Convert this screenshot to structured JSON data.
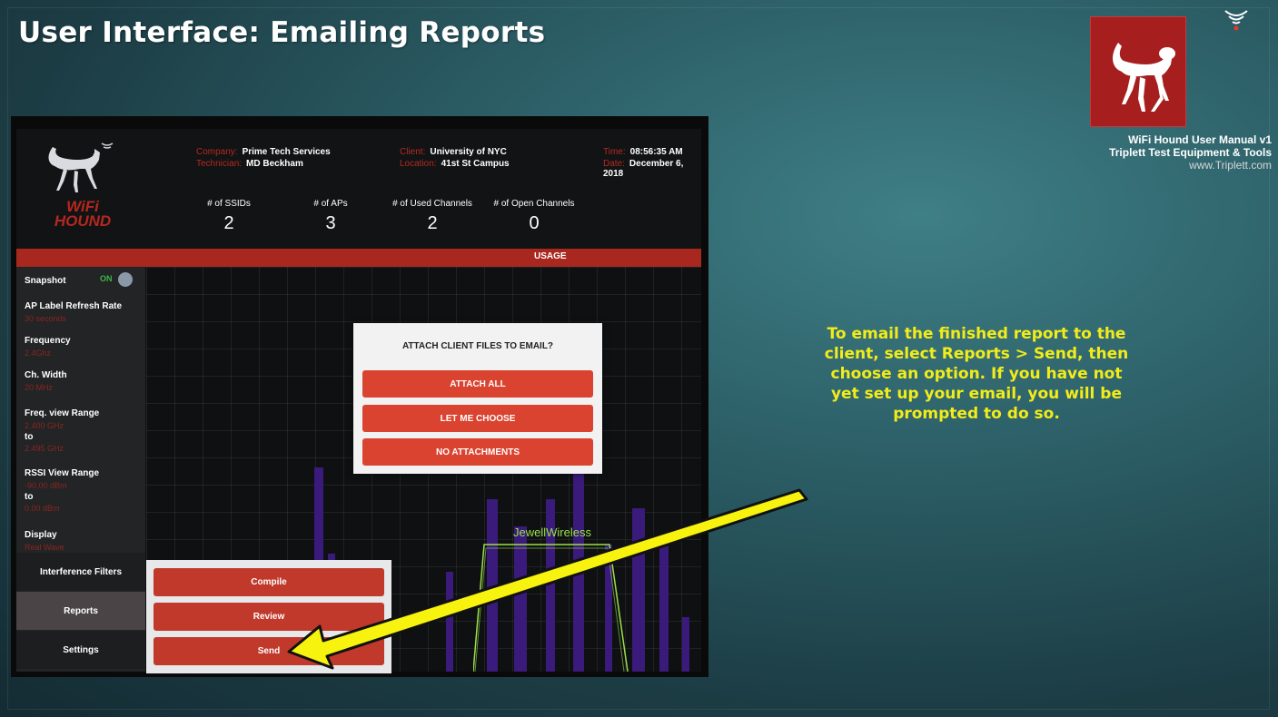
{
  "slide": {
    "title": "User Interface: Emailing Reports",
    "credits": [
      "WiFi Hound User Manual v1",
      "Triplett Test Equipment & Tools",
      "www.Triplett.com"
    ],
    "instructions": "To email the finished report to the client, select Reports > Send, then choose an option. If you have not yet set up your email, you will be prompted to do so.",
    "colors": {
      "accent_yellow": "#f2ec1a",
      "brand_red": "#a61e1e"
    },
    "icons": [
      "dog-logo-icon",
      "wifi-signal-icon",
      "arrow-pointer-icon"
    ]
  },
  "app": {
    "brand": "WiFi HOUND",
    "header": {
      "company_label": "Company:",
      "company": "Prime Tech Services",
      "technician_label": "Technician:",
      "technician": "MD Beckham",
      "client_label": "Client:",
      "client": "University of NYC",
      "location_label": "Location:",
      "location": "41st St Campus",
      "time_label": "Time:",
      "time": "08:56:35 AM",
      "date_label": "Date:",
      "date": "December 6, 2018"
    },
    "stats": [
      {
        "label": "# of SSIDs",
        "value": "2"
      },
      {
        "label": "# of APs",
        "value": "3"
      },
      {
        "label": "# of Used Channels",
        "value": "2"
      },
      {
        "label": "# of Open Channels",
        "value": "0"
      }
    ],
    "usage_label": "USAGE",
    "sidebar": {
      "snapshot_label": "Snapshot",
      "snapshot_state": "ON",
      "refresh_label": "AP Label Refresh Rate",
      "refresh_value": "30 seconds",
      "frequency_label": "Frequency",
      "frequency_value": "2.4Ghz",
      "width_label": "Ch. Width",
      "width_value": "20 MHz",
      "range_label": "Freq. view Range",
      "range_from": "2.400 GHz",
      "range_to_label": "to",
      "range_to": "2.495 GHz",
      "rssi_label": "RSSI View Range",
      "rssi_from": "-90.00 dBm",
      "rssi_to_label": "to",
      "rssi_to": "0.00 dBm",
      "display_label": "Display",
      "display_value": "Real Wave"
    },
    "nav": [
      "Interference Filters",
      "Reports",
      "Settings"
    ],
    "submenu": [
      "Compile",
      "Review",
      "Send"
    ],
    "plot_label": "JewellWireless",
    "dialog": {
      "title": "ATTACH CLIENT FILES TO EMAIL?",
      "options": [
        "ATTACH ALL",
        "LET ME CHOOSE",
        "NO ATTACHMENTS"
      ]
    }
  }
}
